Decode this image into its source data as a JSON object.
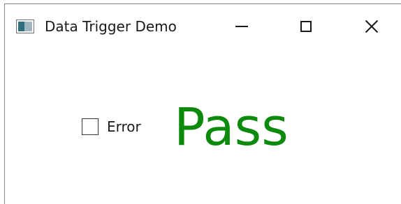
{
  "window": {
    "title": "Data Trigger Demo",
    "icon": "app-window-icon",
    "controls": {
      "minimize_icon": "minimize-icon",
      "maximize_icon": "maximize-icon",
      "close_icon": "close-icon"
    }
  },
  "content": {
    "error_checkbox": {
      "label": "Error",
      "checked": false
    },
    "status": {
      "text": "Pass",
      "color": "#0b8a0b"
    }
  }
}
